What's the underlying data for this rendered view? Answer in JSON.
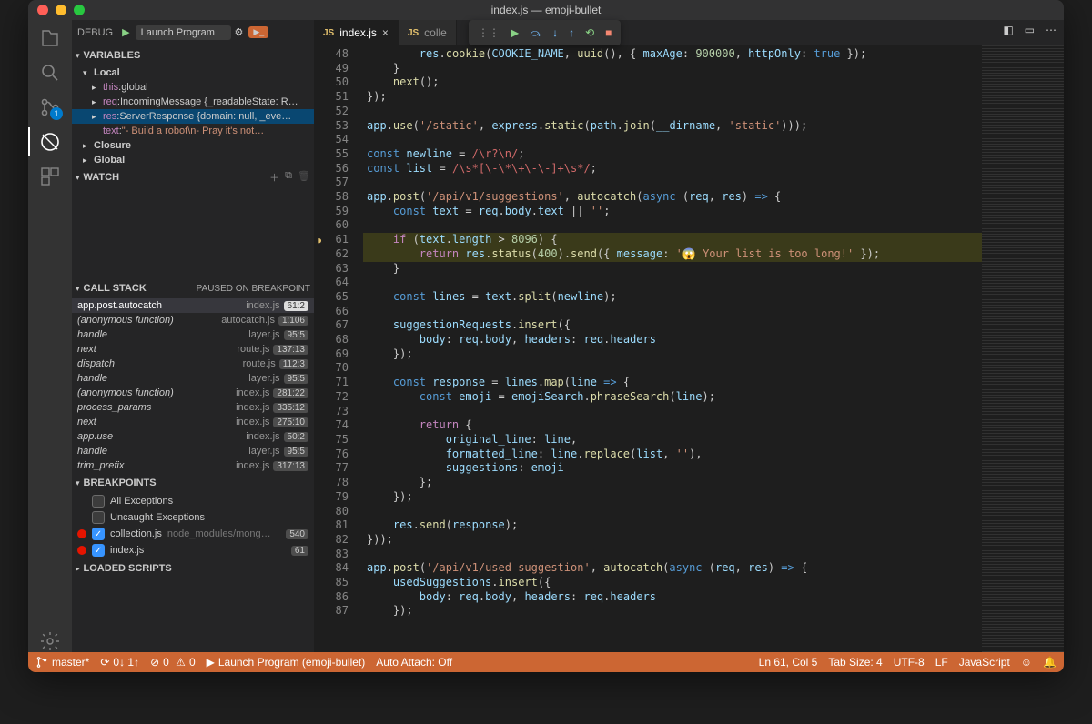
{
  "window_title": "index.js — emoji-bullet",
  "debug_label": "DEBUG",
  "launch_config": "Launch Program",
  "tabs": [
    {
      "name": "index.js",
      "active": true
    },
    {
      "name": "colle",
      "active": false
    }
  ],
  "panels": {
    "variables": {
      "title": "VARIABLES",
      "scopes": [
        {
          "name": "Local",
          "expanded": true,
          "vars": [
            {
              "name": "this",
              "value": "global",
              "expandable": true
            },
            {
              "name": "req",
              "value": "IncomingMessage {_readableState: R…",
              "expandable": true
            },
            {
              "name": "res",
              "value": "ServerResponse {domain: null, _eve…",
              "expandable": true,
              "selected": true
            },
            {
              "name": "text",
              "value": "\"- Build a robot\\n- Pray it's not…",
              "expandable": false,
              "string": true
            }
          ]
        },
        {
          "name": "Closure",
          "expanded": false
        },
        {
          "name": "Global",
          "expanded": false
        }
      ]
    },
    "watch": {
      "title": "WATCH"
    },
    "callstack": {
      "title": "CALL STACK",
      "status": "PAUSED ON BREAKPOINT",
      "frames": [
        {
          "fn": "app.post.autocatch",
          "file": "index.js",
          "pos": "61:2",
          "selected": true
        },
        {
          "fn": "(anonymous function)",
          "file": "autocatch.js",
          "pos": "1:106"
        },
        {
          "fn": "handle",
          "file": "layer.js",
          "pos": "95:5"
        },
        {
          "fn": "next",
          "file": "route.js",
          "pos": "137:13"
        },
        {
          "fn": "dispatch",
          "file": "route.js",
          "pos": "112:3"
        },
        {
          "fn": "handle",
          "file": "layer.js",
          "pos": "95:5"
        },
        {
          "fn": "(anonymous function)",
          "file": "index.js",
          "pos": "281:22"
        },
        {
          "fn": "process_params",
          "file": "index.js",
          "pos": "335:12"
        },
        {
          "fn": "next",
          "file": "index.js",
          "pos": "275:10"
        },
        {
          "fn": "app.use",
          "file": "index.js",
          "pos": "50:2"
        },
        {
          "fn": "handle",
          "file": "layer.js",
          "pos": "95:5"
        },
        {
          "fn": "trim_prefix",
          "file": "index.js",
          "pos": "317:13"
        }
      ]
    },
    "breakpoints": {
      "title": "BREAKPOINTS",
      "builtin": [
        {
          "label": "All Exceptions",
          "checked": false
        },
        {
          "label": "Uncaught Exceptions",
          "checked": false
        }
      ],
      "items": [
        {
          "file": "collection.js",
          "path": "node_modules/mong…",
          "pos": "540",
          "checked": true
        },
        {
          "file": "index.js",
          "path": "",
          "pos": "61",
          "checked": true
        }
      ]
    },
    "loaded": {
      "title": "LOADED SCRIPTS"
    }
  },
  "scm_badge": "1",
  "code_lines": [
    {
      "n": 48,
      "html": "        <span class='v'>res</span>.<span class='f'>cookie</span>(<span class='v'>COOKIE_NAME</span>, <span class='f'>uuid</span>(), { <span class='v'>maxAge</span>: <span class='n'>900000</span>, <span class='v'>httpOnly</span>: <span class='k'>true</span> });"
    },
    {
      "n": 49,
      "html": "    }"
    },
    {
      "n": 50,
      "html": "    <span class='f'>next</span>();"
    },
    {
      "n": 51,
      "html": "});"
    },
    {
      "n": 52,
      "html": ""
    },
    {
      "n": 53,
      "html": "<span class='v'>app</span>.<span class='f'>use</span>(<span class='s'>'/static'</span>, <span class='v'>express</span>.<span class='f'>static</span>(<span class='v'>path</span>.<span class='f'>join</span>(<span class='v'>__dirname</span>, <span class='s'>'static'</span>)));"
    },
    {
      "n": 54,
      "html": ""
    },
    {
      "n": 55,
      "html": "<span class='k'>const</span> <span class='v'>newline</span> = <span class='r'>/\\r?\\n/</span>;"
    },
    {
      "n": 56,
      "html": "<span class='k'>const</span> <span class='v'>list</span> = <span class='r'>/\\s*[\\-\\*\\+\\-\\-]+\\s*/</span>;"
    },
    {
      "n": 57,
      "html": ""
    },
    {
      "n": 58,
      "html": "<span class='v'>app</span>.<span class='f'>post</span>(<span class='s'>'/api/v1/suggestions'</span>, <span class='f'>autocatch</span>(<span class='k'>async</span> (<span class='v'>req</span>, <span class='v'>res</span>) <span class='k'>=&gt;</span> {"
    },
    {
      "n": 59,
      "html": "    <span class='k'>const</span> <span class='v'>text</span> = <span class='v'>req</span>.<span class='v'>body</span>.<span class='v'>text</span> || <span class='s'>''</span>;"
    },
    {
      "n": 60,
      "html": ""
    },
    {
      "n": 61,
      "html": "    <span class='m'>if</span> (<span class='v'>text</span>.<span class='v'>length</span> &gt; <span class='n'>8096</span>) {",
      "hl": true,
      "bp": true
    },
    {
      "n": 62,
      "html": "        <span class='m'>return</span> <span class='v'>res</span>.<span class='f'>status</span>(<span class='n'>400</span>).<span class='f'>send</span>({ <span class='v'>message</span>: <span class='s'>'😱 Your list is too long!'</span> });",
      "hl": true
    },
    {
      "n": 63,
      "html": "    }"
    },
    {
      "n": 64,
      "html": ""
    },
    {
      "n": 65,
      "html": "    <span class='k'>const</span> <span class='v'>lines</span> = <span class='v'>text</span>.<span class='f'>split</span>(<span class='v'>newline</span>);"
    },
    {
      "n": 66,
      "html": ""
    },
    {
      "n": 67,
      "html": "    <span class='v'>suggestionRequests</span>.<span class='f'>insert</span>({"
    },
    {
      "n": 68,
      "html": "        <span class='v'>body</span>: <span class='v'>req</span>.<span class='v'>body</span>, <span class='v'>headers</span>: <span class='v'>req</span>.<span class='v'>headers</span>"
    },
    {
      "n": 69,
      "html": "    });"
    },
    {
      "n": 70,
      "html": ""
    },
    {
      "n": 71,
      "html": "    <span class='k'>const</span> <span class='v'>response</span> = <span class='v'>lines</span>.<span class='f'>map</span>(<span class='v'>line</span> <span class='k'>=&gt;</span> {"
    },
    {
      "n": 72,
      "html": "        <span class='k'>const</span> <span class='v'>emoji</span> = <span class='v'>emojiSearch</span>.<span class='f'>phraseSearch</span>(<span class='v'>line</span>);"
    },
    {
      "n": 73,
      "html": ""
    },
    {
      "n": 74,
      "html": "        <span class='m'>return</span> {"
    },
    {
      "n": 75,
      "html": "            <span class='v'>original_line</span>: <span class='v'>line</span>,"
    },
    {
      "n": 76,
      "html": "            <span class='v'>formatted_line</span>: <span class='v'>line</span>.<span class='f'>replace</span>(<span class='v'>list</span>, <span class='s'>''</span>),"
    },
    {
      "n": 77,
      "html": "            <span class='v'>suggestions</span>: <span class='v'>emoji</span>"
    },
    {
      "n": 78,
      "html": "        };"
    },
    {
      "n": 79,
      "html": "    });"
    },
    {
      "n": 80,
      "html": ""
    },
    {
      "n": 81,
      "html": "    <span class='v'>res</span>.<span class='f'>send</span>(<span class='v'>response</span>);"
    },
    {
      "n": 82,
      "html": "}));"
    },
    {
      "n": 83,
      "html": ""
    },
    {
      "n": 84,
      "html": "<span class='v'>app</span>.<span class='f'>post</span>(<span class='s'>'/api/v1/used-suggestion'</span>, <span class='f'>autocatch</span>(<span class='k'>async</span> (<span class='v'>req</span>, <span class='v'>res</span>) <span class='k'>=&gt;</span> {"
    },
    {
      "n": 85,
      "html": "    <span class='v'>usedSuggestions</span>.<span class='f'>insert</span>({"
    },
    {
      "n": 86,
      "html": "        <span class='v'>body</span>: <span class='v'>req</span>.<span class='v'>body</span>, <span class='v'>headers</span>: <span class='v'>req</span>.<span class='v'>headers</span>"
    },
    {
      "n": 87,
      "html": "    });"
    }
  ],
  "statusbar": {
    "branch": "master*",
    "sync": "0↓ 1↑",
    "errors": "0",
    "warnings": "0",
    "launch": "Launch Program (emoji-bullet)",
    "auto_attach": "Auto Attach: Off",
    "lncol": "Ln 61, Col 5",
    "tabsize": "Tab Size: 4",
    "encoding": "UTF-8",
    "eol": "LF",
    "lang": "JavaScript"
  }
}
